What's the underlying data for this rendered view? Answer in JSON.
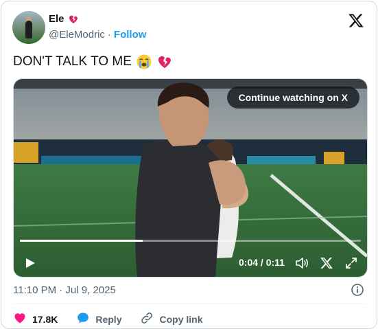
{
  "author": {
    "name": "Ele",
    "handle": "@EleModric",
    "separator": "·",
    "follow_label": "Follow"
  },
  "tweet": {
    "text": "DON'T TALK TO ME"
  },
  "video": {
    "cta_label": "Continue watching on X",
    "time_display": "0:04 / 0:11",
    "progress": 0.36
  },
  "meta": {
    "timestamp": "11:10 PM · Jul 9, 2025"
  },
  "actions": {
    "likes": "17.8K",
    "reply_label": "Reply",
    "copy_link_label": "Copy link"
  },
  "icons": {
    "brand": "x-logo-icon",
    "heart": "red-heart-icon",
    "comment": "reply-bubble-icon",
    "link": "link-icon",
    "emoji1": "loudly-crying-face-icon",
    "emoji2": "broken-heart-icon"
  },
  "colors": {
    "accent": "#1d9bf0",
    "like": "#f91880",
    "muted": "#536471",
    "text": "#0f1419"
  }
}
